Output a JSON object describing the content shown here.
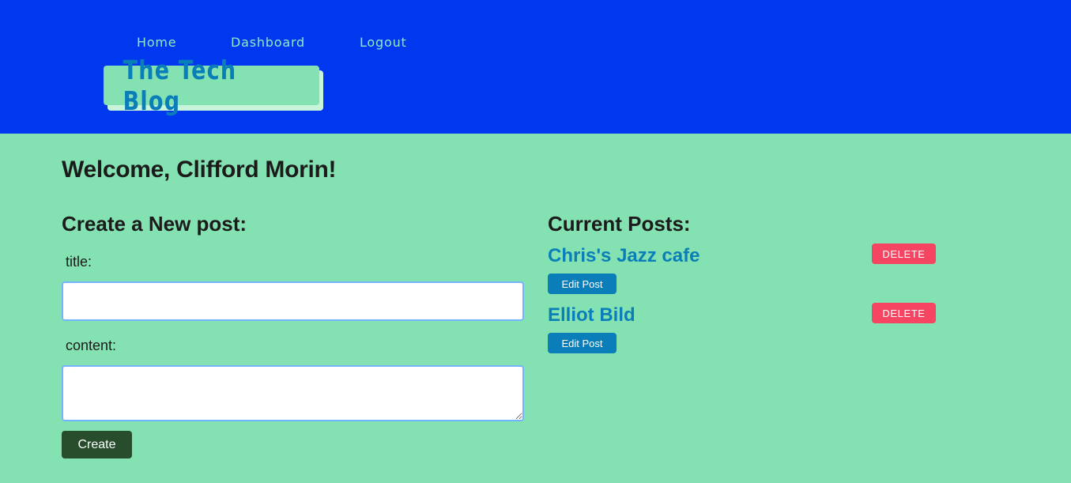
{
  "nav": {
    "home": "Home",
    "dashboard": "Dashboard",
    "logout": "Logout"
  },
  "brand": {
    "title": "The Tech Blog"
  },
  "welcome": "Welcome, Clifford Morin!",
  "create_post": {
    "heading": "Create a New post:",
    "title_label": "title:",
    "title_value": "",
    "content_label": "content:",
    "content_value": "",
    "submit_label": "Create"
  },
  "current_posts": {
    "heading": "Current Posts:",
    "posts": [
      {
        "title": "Chris's Jazz cafe",
        "delete_label": "DELETE",
        "edit_label": "Edit Post"
      },
      {
        "title": "Elliot Bild",
        "delete_label": "DELETE",
        "edit_label": "Edit Post"
      }
    ]
  },
  "colors": {
    "header_bg": "#0038ef",
    "page_bg": "#84e2b2",
    "nav_text": "#8fe8c6",
    "brand_text": "#0a7eb8",
    "create_button": "#274d2c",
    "delete_button": "#f64563",
    "edit_button": "#0a7eb8",
    "input_border": "#74b4ff"
  }
}
